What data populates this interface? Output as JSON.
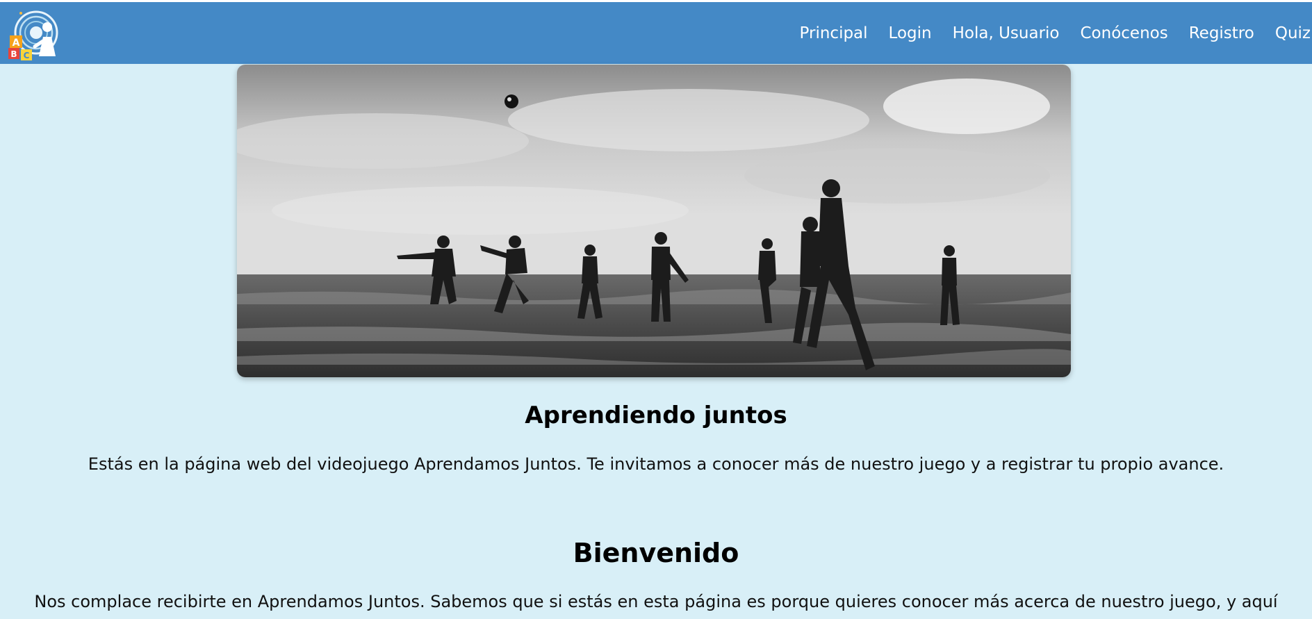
{
  "brand": {
    "logo_icon": "child-learning-logo-icon",
    "logo_letters": [
      "A",
      "B",
      "C"
    ]
  },
  "nav": {
    "items": [
      {
        "label": "Principal"
      },
      {
        "label": "Login"
      },
      {
        "label": "Hola, Usuario"
      },
      {
        "label": "Conócenos"
      },
      {
        "label": "Registro"
      },
      {
        "label": "Quiz"
      }
    ]
  },
  "hero": {
    "image": "kids-playing-soccer-on-beach-bw-photo"
  },
  "intro": {
    "title": "Aprendiendo juntos",
    "text": "Estás en la página web del videojuego Aprendamos Juntos. Te invitamos a conocer más de nuestro juego y a registrar tu propio avance."
  },
  "welcome": {
    "title": "Bienvenido",
    "text": "Nos complace recibirte en Aprendamos Juntos. Sabemos que si estás en esta página es porque quieres conocer más acerca de nuestro juego, y aquí"
  },
  "colors": {
    "navbar": "#4489c6",
    "background": "#d8eff7",
    "nav_text": "#ffffff"
  }
}
